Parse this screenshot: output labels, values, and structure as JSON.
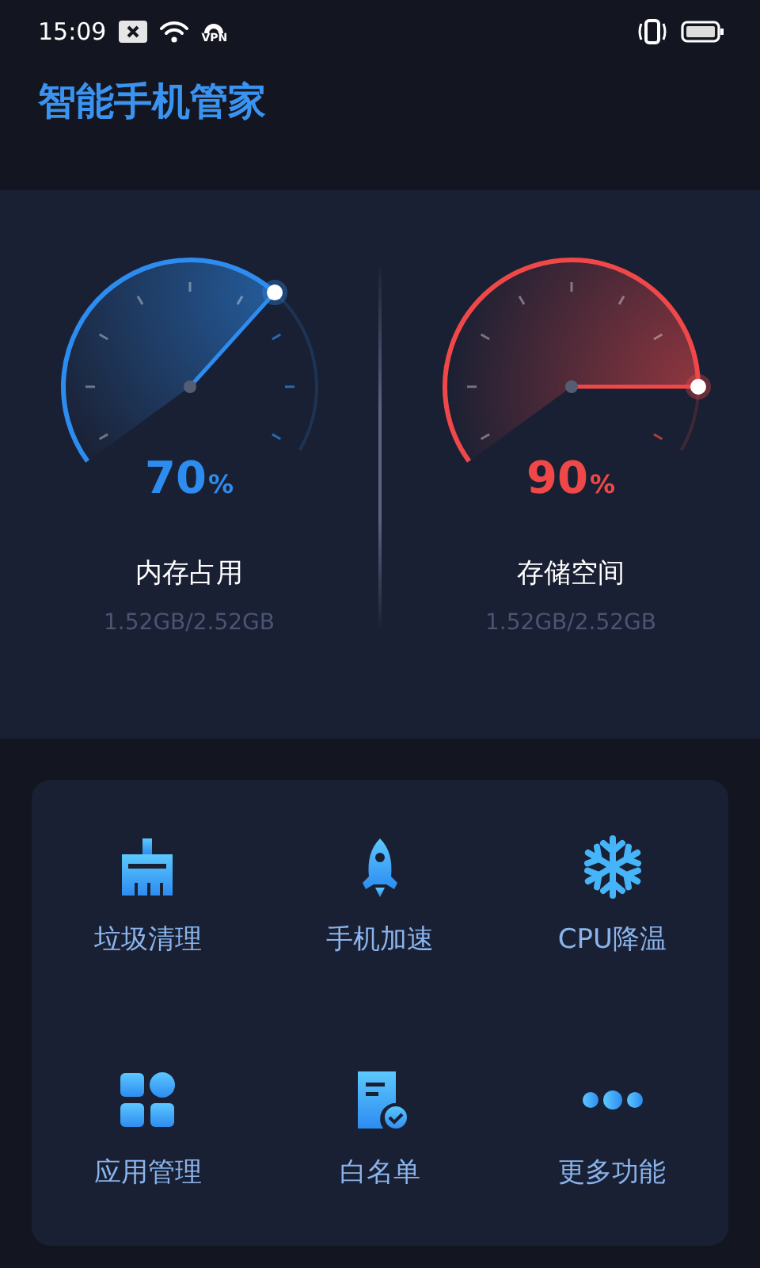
{
  "status_bar": {
    "time": "15:09",
    "vpn_label": "VPN"
  },
  "header": {
    "title": "智能手机管家"
  },
  "gauges": [
    {
      "value": "70",
      "unit": "%",
      "color": "#2d8cf0",
      "label": "内存占用",
      "detail": "1.52GB/2.52GB"
    },
    {
      "value": "90",
      "unit": "%",
      "color": "#f04848",
      "label": "存储空间",
      "detail": "1.52GB/2.52GB"
    }
  ],
  "tools": [
    {
      "kind": "clean",
      "label": "垃圾清理"
    },
    {
      "kind": "boost",
      "label": "手机加速"
    },
    {
      "kind": "cool",
      "label": "CPU降温"
    },
    {
      "kind": "apps",
      "label": "应用管理"
    },
    {
      "kind": "whitelist",
      "label": "白名单"
    },
    {
      "kind": "more",
      "label": "更多功能"
    }
  ]
}
